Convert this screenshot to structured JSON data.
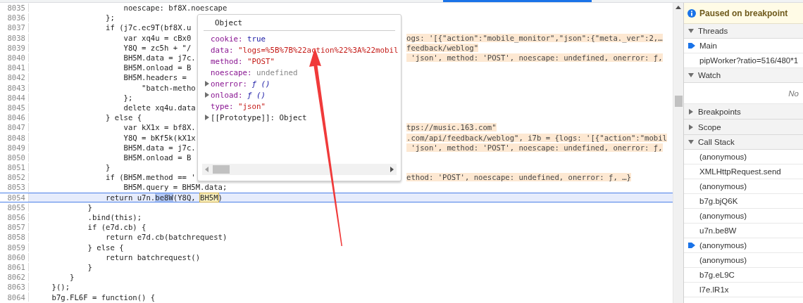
{
  "editor": {
    "lines": [
      {
        "number": "8035",
        "current": false,
        "code": "                    noescape: bf8X.noescape"
      },
      {
        "number": "8036",
        "current": false,
        "code": "                };"
      },
      {
        "number": "8037",
        "current": false,
        "code": "                if (j7c.ec9T(bf8X.u"
      },
      {
        "number": "8038",
        "current": false,
        "code": "                    var xq4u = cBx0",
        "annotation": "ogs: '[{\"action\":\"mobile_monitor\",\"json\":{\"meta._ver\":2,…"
      },
      {
        "number": "8039",
        "current": false,
        "code": "                    Y8Q = zc5h + \"/",
        "annotation": "feedback/weblog\""
      },
      {
        "number": "8040",
        "current": false,
        "code": "                    BH5M.data = j7c.",
        "annotation": " 'json', method: 'POST', noescape: undefined, onerror: ƒ,"
      },
      {
        "number": "8041",
        "current": false,
        "code": "                    BH5M.onload = B"
      },
      {
        "number": "8042",
        "current": false,
        "code": "                    BH5M.headers ="
      },
      {
        "number": "8043",
        "current": false,
        "code": "                        \"batch-metho"
      },
      {
        "number": "8044",
        "current": false,
        "code": "                    };"
      },
      {
        "number": "8045",
        "current": false,
        "code": "                    delete xq4u.data"
      },
      {
        "number": "8046",
        "current": false,
        "code": "                } else {"
      },
      {
        "number": "8047",
        "current": false,
        "code": "                    var kX1x = bf8X.",
        "annotation": "tps://music.163.com\""
      },
      {
        "number": "8048",
        "current": false,
        "code": "                    Y8Q = bKf5k(kX1x",
        "annotation": ".com/api/feedback/weblog\", i7b = {logs: '[{\"action\":\"mobil"
      },
      {
        "number": "8049",
        "current": false,
        "code": "                    BH5M.data = j7c.",
        "annotation": " 'json', method: 'POST', noescape: undefined, onerror: ƒ,"
      },
      {
        "number": "8050",
        "current": false,
        "code": "                    BH5M.onload = B"
      },
      {
        "number": "8051",
        "current": false,
        "code": "                }"
      },
      {
        "number": "8052",
        "current": false,
        "code": "                if (BH5M.method == '",
        "annotation": "ethod: 'POST', noescape: undefined, onerror: ƒ, …}"
      },
      {
        "number": "8053",
        "current": false,
        "code": "                    BH5M.query = BH5M.data;"
      },
      {
        "number": "8054",
        "current": true,
        "segments": [
          {
            "kind": "plain",
            "text": "                return u7n."
          },
          {
            "kind": "selected",
            "text": "be8W"
          },
          {
            "kind": "plain",
            "text": "(Y8Q, "
          },
          {
            "kind": "highlighted",
            "text": "BH5M"
          },
          {
            "kind": "plain",
            "text": ")"
          }
        ]
      },
      {
        "number": "8055",
        "current": false,
        "code": "            }"
      },
      {
        "number": "8056",
        "current": false,
        "code": "            .bind(this);"
      },
      {
        "number": "8057",
        "current": false,
        "code": "            if (e7d.cb) {"
      },
      {
        "number": "8058",
        "current": false,
        "code": "                return e7d.cb(batchrequest)"
      },
      {
        "number": "8059",
        "current": false,
        "code": "            } else {"
      },
      {
        "number": "8060",
        "current": false,
        "code": "                return batchrequest()"
      },
      {
        "number": "8061",
        "current": false,
        "code": "            }"
      },
      {
        "number": "8062",
        "current": false,
        "code": "        }"
      },
      {
        "number": "8063",
        "current": false,
        "code": "    }();"
      },
      {
        "number": "8064",
        "current": false,
        "code": "    b7g.FL6F = function() {"
      }
    ]
  },
  "popover": {
    "title": "Object",
    "properties": [
      {
        "key": "cookie:",
        "value": "true",
        "kind": "boolean",
        "expandable": false
      },
      {
        "key": "data:",
        "value": "\"logs=%5B%7B%22action%22%3A%22mobil",
        "kind": "string",
        "expandable": false
      },
      {
        "key": "method:",
        "value": "\"POST\"",
        "kind": "string",
        "expandable": false
      },
      {
        "key": "noescape:",
        "value": "undefined",
        "kind": "undefined",
        "expandable": false
      },
      {
        "key": "onerror:",
        "value": "ƒ ()",
        "kind": "function",
        "expandable": true
      },
      {
        "key": "onload:",
        "value": "ƒ ()",
        "kind": "function",
        "expandable": true
      },
      {
        "key": "type:",
        "value": "\"json\"",
        "kind": "string",
        "expandable": false
      },
      {
        "key": "[[Prototype]]:",
        "value": "Object",
        "kind": "object",
        "expandable": true
      }
    ]
  },
  "debugger": {
    "status": "Paused on breakpoint",
    "sections": [
      {
        "title": "Threads",
        "expanded": true,
        "items": [
          {
            "label": "Main",
            "selected": true
          },
          {
            "label": "pipWorker?ratio=516/480*1",
            "selected": false
          }
        ]
      },
      {
        "title": "Watch",
        "expanded": true,
        "empty_text": "No"
      },
      {
        "title": "Breakpoints",
        "expanded": false
      },
      {
        "title": "Scope",
        "expanded": false
      },
      {
        "title": "Call Stack",
        "expanded": true,
        "items": [
          {
            "label": "(anonymous)",
            "selected": false
          },
          {
            "label": "XMLHttpRequest.send",
            "selected": false
          },
          {
            "label": "(anonymous)",
            "selected": false
          },
          {
            "label": "b7g.bjQ6K",
            "selected": false
          },
          {
            "label": "(anonymous)",
            "selected": false
          },
          {
            "label": "u7n.be8W",
            "selected": false
          },
          {
            "label": "(anonymous)",
            "selected": true
          },
          {
            "label": "(anonymous)",
            "selected": false
          },
          {
            "label": "b7g.eL9C",
            "selected": false
          },
          {
            "label": "l7e.lR1x",
            "selected": false
          }
        ]
      }
    ]
  }
}
